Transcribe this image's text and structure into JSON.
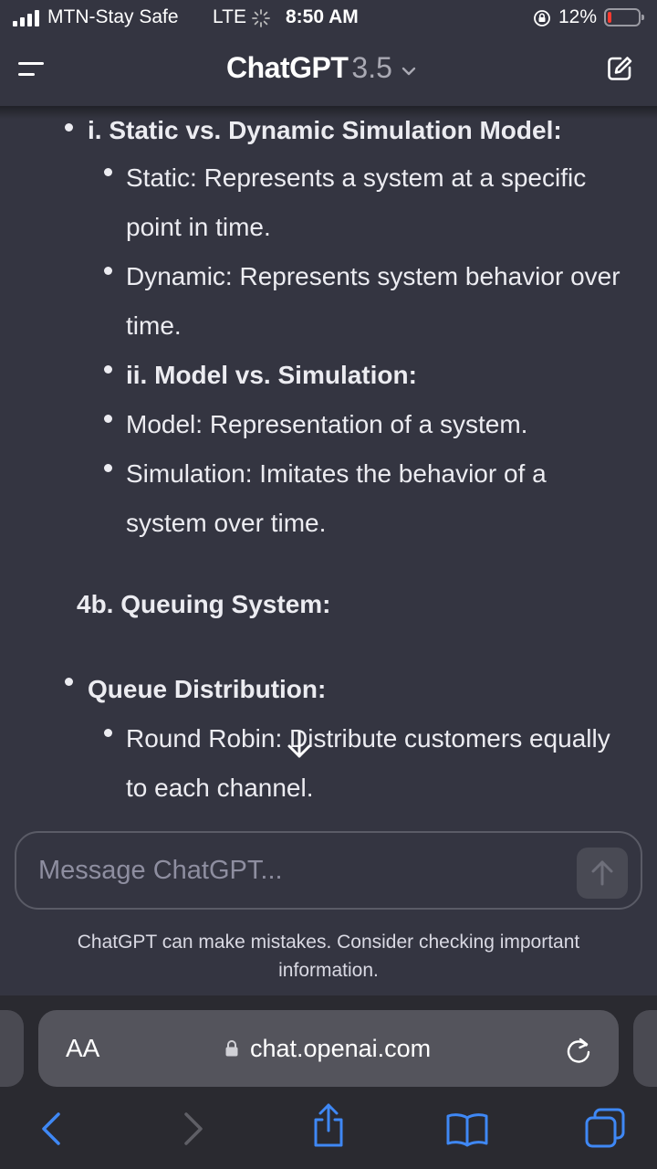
{
  "status_bar": {
    "carrier": "MTN-Stay Safe",
    "network": "LTE",
    "time": "8:50 AM",
    "battery": "12%",
    "battery_level": 0.12,
    "battery_color": "#ff3b30"
  },
  "header": {
    "title": "ChatGPT",
    "version": "3.5",
    "menu_icon": "menu-icon",
    "new_chat_icon": "edit-icon",
    "dropdown_icon": "chevron-down-icon"
  },
  "content": {
    "section1_heading": "i. Static vs. Dynamic Simulation Model:",
    "static_line1": "Static: Represents a system at a specific",
    "static_line2": "point in time.",
    "dynamic_line1": "Dynamic: Represents system behavior over",
    "dynamic_line2": "time.",
    "section2_heading": "ii. Model vs. Simulation:",
    "model_line": "Model: Representation of a system.",
    "simulation_line1": "Simulation: Imitates the behavior of a",
    "simulation_line2": "system over time.",
    "queuing_heading": "4b. Queuing System:",
    "queue_dist_heading": "Queue Distribution:",
    "round_robin_line1": "Round Robin: Distribute customers equally",
    "round_robin_line2": "to each channel."
  },
  "composer": {
    "placeholder": "Message ChatGPT...",
    "send_icon": "arrow-up-icon",
    "scroll_icon": "arrow-down-icon"
  },
  "disclaimer": "ChatGPT can make mistakes. Consider checking important information.",
  "browser": {
    "text_size_label": "AA",
    "url": "chat.openai.com",
    "reload_icon": "reload-icon",
    "toolbar": [
      "back-icon",
      "forward-icon",
      "share-icon",
      "bookmarks-icon",
      "tabs-icon"
    ],
    "accent": "#3f88f5"
  }
}
